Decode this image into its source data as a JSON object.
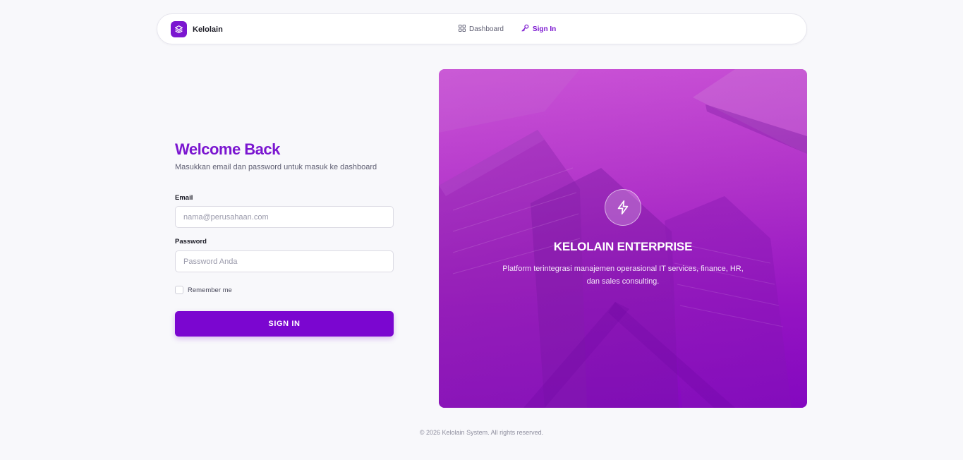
{
  "nav": {
    "brand": "Kelolain",
    "links": [
      {
        "label": "Dashboard",
        "icon": "grid-icon"
      },
      {
        "label": "Sign In",
        "icon": "key-icon",
        "active": true
      }
    ]
  },
  "form": {
    "title": "Welcome Back",
    "subtitle": "Masukkan email dan password untuk masuk ke dashboard",
    "email_label": "Email",
    "email_placeholder": "nama@perusahaan.com",
    "email_value": "",
    "password_label": "Password",
    "password_placeholder": "Password Anda",
    "password_value": "",
    "remember_label": "Remember me",
    "remember_checked": false,
    "submit_label": "SIGN IN"
  },
  "hero": {
    "icon": "lightning-icon",
    "title": "KELOLAIN ENTERPRISE",
    "description": "Platform terintegrasi manajemen operasional IT services, finance, HR, dan sales consulting."
  },
  "footer": {
    "text": "© 2026 Kelolain System. All rights reserved."
  },
  "colors": {
    "accent": "#7b16d0",
    "button": "#7b06d0",
    "page_bg": "#f8f8fb",
    "hero_top": "#c64ad2",
    "hero_bottom": "#8a0cbb"
  }
}
